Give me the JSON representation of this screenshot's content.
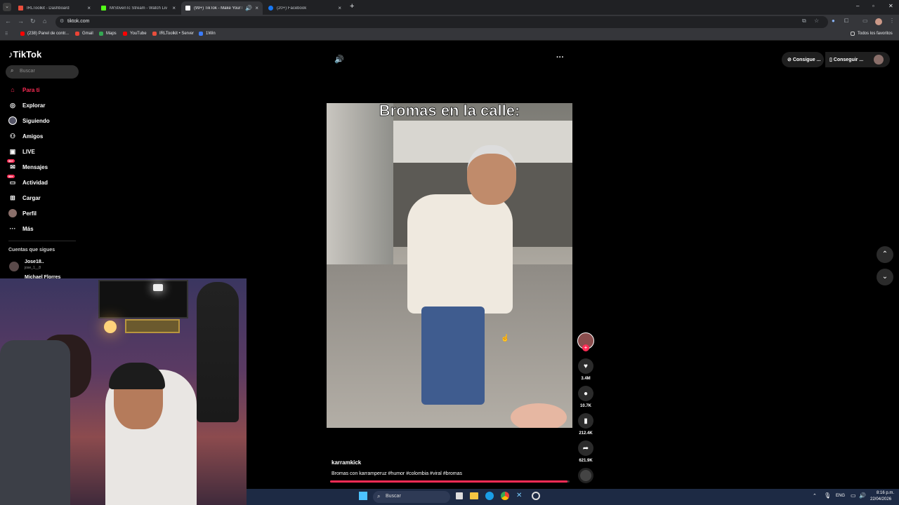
{
  "browser": {
    "tabs": [
      {
        "title": "IRLToolkit - Dashboard",
        "favicon_color": "#e94e3c"
      },
      {
        "title": "MrStivenTc Stream - Watch Liv",
        "favicon_color": "#53fc18"
      },
      {
        "title": "(99+) TikTok - Make Your Day",
        "favicon_color": "#ffffff"
      },
      {
        "title": "(20+) Facebook",
        "favicon_color": "#1877f2"
      }
    ],
    "url": "tiktok.com",
    "bookmarks": [
      {
        "label": "(238) Panel de contr...",
        "color": "#ff0000"
      },
      {
        "label": "Gmail",
        "color": "#ea4335"
      },
      {
        "label": "Maps",
        "color": "#34a853"
      },
      {
        "label": "YouTube",
        "color": "#ff0000"
      },
      {
        "label": "IRLToolkit • Server",
        "color": "#e94e3c"
      },
      {
        "label": "1Win",
        "color": "#3b7cff"
      }
    ],
    "all_bookmarks": "Todos los favoritos"
  },
  "tiktok": {
    "logo": "TikTok",
    "search_placeholder": "Buscar",
    "menu": [
      {
        "label": "Para ti",
        "icon": "home-icon",
        "active": true
      },
      {
        "label": "Explorar",
        "icon": "compass-icon"
      },
      {
        "label": "Siguiendo",
        "icon": "following-icon"
      },
      {
        "label": "Amigos",
        "icon": "friends-icon"
      },
      {
        "label": "LIVE",
        "icon": "live-icon"
      },
      {
        "label": "Mensajes",
        "icon": "messages-icon",
        "badge": "99+"
      },
      {
        "label": "Actividad",
        "icon": "activity-icon",
        "badge": "99+"
      },
      {
        "label": "Cargar",
        "icon": "upload-icon"
      },
      {
        "label": "Perfil",
        "icon": "profile-icon"
      },
      {
        "label": "Más",
        "icon": "more-icon"
      }
    ],
    "following_heading": "Cuentas que sigues",
    "following": [
      {
        "name": "Jose18..",
        "handle": "jose_1__8"
      },
      {
        "name": "Michael Florres"
      }
    ],
    "top_right": {
      "btn1": "Consigue ...",
      "btn2": "Conseguir ..."
    },
    "video": {
      "caption_overlay": "Bromas en la calle:",
      "author": "karramkick",
      "description": "Bromas con karramperuz #humor #colombia #viral #bromas",
      "likes": "3.4M",
      "comments": "10.7K",
      "saves": "212.4K",
      "shares": "621.9K",
      "progress": 0.99
    }
  },
  "taskbar": {
    "search": "Buscar",
    "lang": "ENG",
    "time": "8:16 p.m.",
    "date": "22/04/2026"
  }
}
